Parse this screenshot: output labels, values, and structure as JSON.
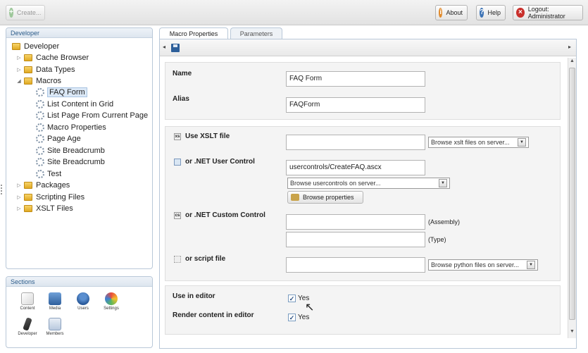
{
  "topbar": {
    "create_label": "Create...",
    "about_label": "About",
    "help_label": "Help",
    "logout_label": "Logout: Administrator"
  },
  "tree_panel": {
    "title": "Developer",
    "root": "Developer",
    "items": [
      {
        "label": "Cache Browser"
      },
      {
        "label": "Data Types"
      },
      {
        "label": "Macros"
      },
      {
        "label": "FAQ Form"
      },
      {
        "label": "List Content in Grid"
      },
      {
        "label": "List Page From Current Page"
      },
      {
        "label": "Macro Properties"
      },
      {
        "label": "Page Age"
      },
      {
        "label": "Site Breadcrumb"
      },
      {
        "label": "Site Breadcrumb"
      },
      {
        "label": "Test"
      },
      {
        "label": "Packages"
      },
      {
        "label": "Scripting Files"
      },
      {
        "label": "XSLT Files"
      }
    ]
  },
  "sections_panel": {
    "title": "Sections",
    "items": [
      {
        "label": "Content",
        "icon": "content-icon"
      },
      {
        "label": "Media",
        "icon": "media-icon"
      },
      {
        "label": "Users",
        "icon": "users-icon"
      },
      {
        "label": "Settings",
        "icon": "settings-icon"
      },
      {
        "label": "Developer",
        "icon": "developer-icon"
      },
      {
        "label": "Members",
        "icon": "members-icon"
      }
    ]
  },
  "tabs": [
    {
      "label": "Macro Properties",
      "active": true
    },
    {
      "label": "Parameters",
      "active": false
    }
  ],
  "form": {
    "name_label": "Name",
    "name_value": "FAQ Form",
    "alias_label": "Alias",
    "alias_value": "FAQForm",
    "xslt_label": "Use XSLT file",
    "xslt_value": "",
    "xslt_browse": "Browse xslt files on server...",
    "usercontrol_label": "or .NET User Control",
    "usercontrol_value": "usercontrols/CreateFAQ.ascx",
    "usercontrol_browse": "Browse usercontrols on server...",
    "browse_properties": "Browse properties",
    "custom_label": "or .NET Custom Control",
    "assembly_hint": "(Assembly)",
    "type_hint": "(Type)",
    "script_label": "or script file",
    "script_browse": "Browse python files on server...",
    "use_in_editor_label": "Use in editor",
    "use_in_editor_text": "Yes",
    "render_label": "Render content in editor",
    "render_text": "Yes"
  }
}
